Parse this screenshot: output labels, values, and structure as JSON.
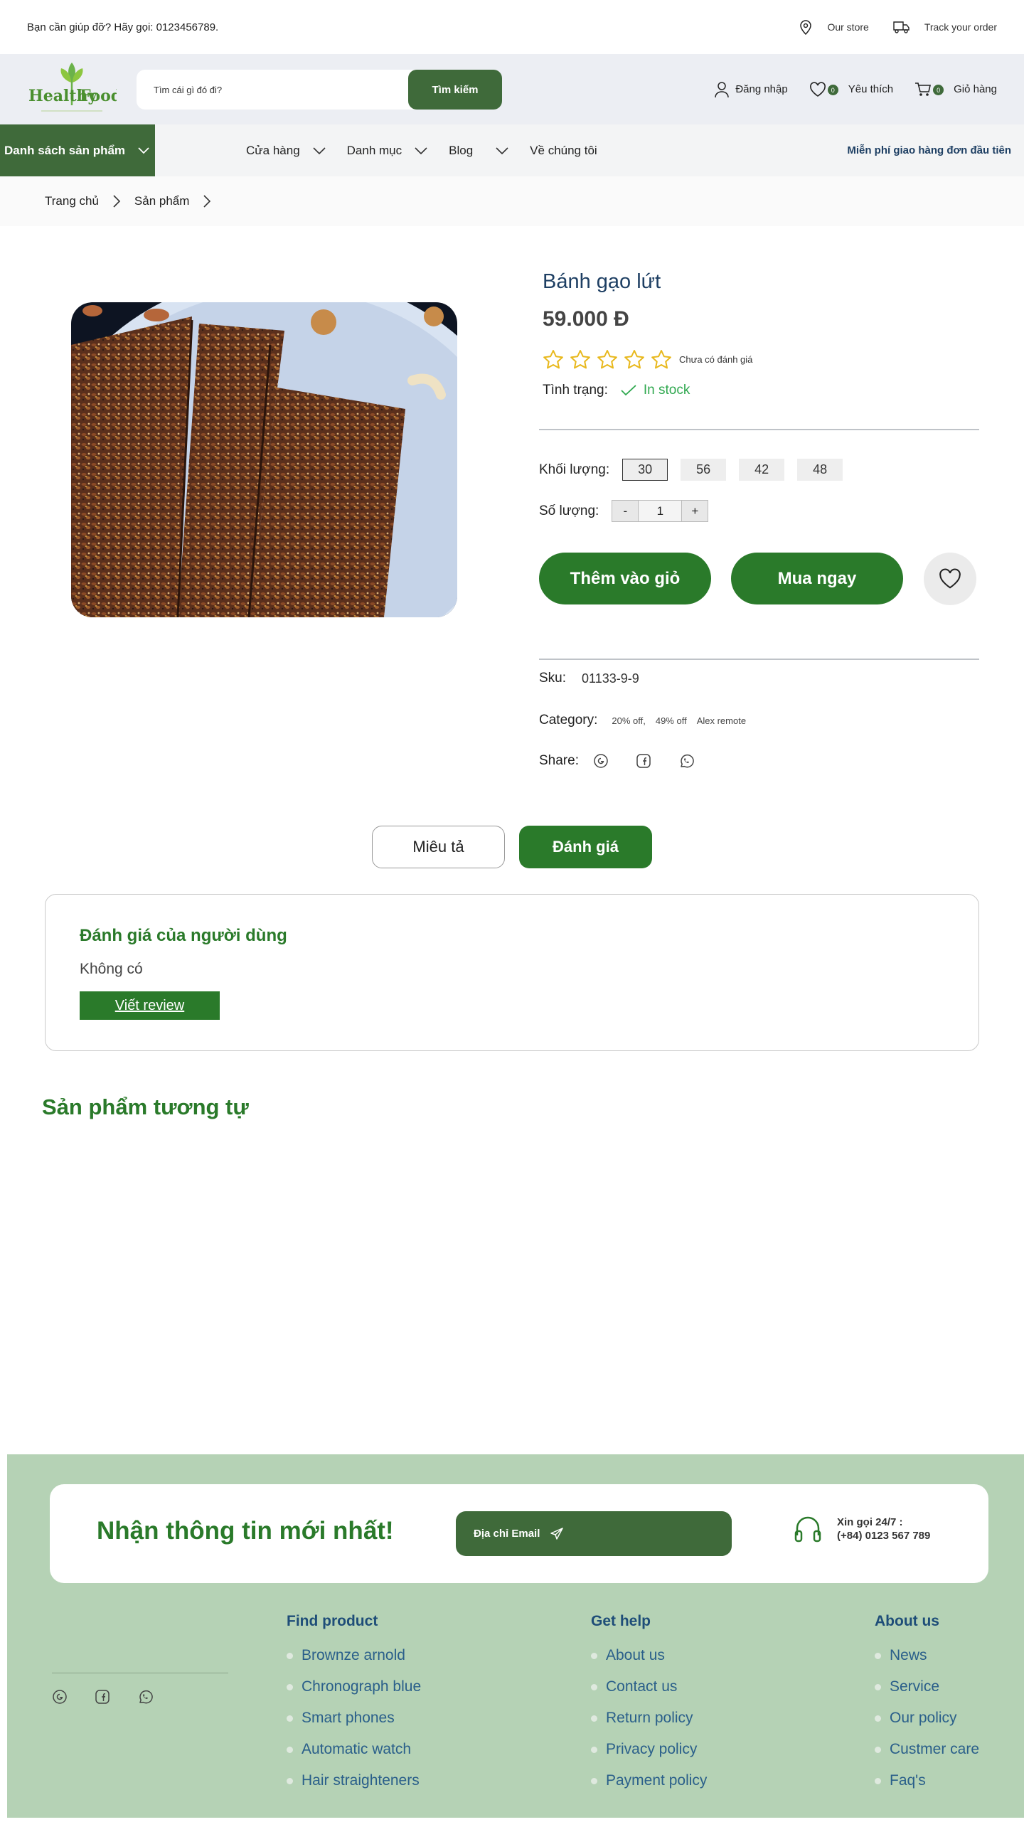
{
  "topbar": {
    "help_text": "Bạn cần giúp đỡ? Hãy gọi: 0123456789.",
    "store_label": "Our store",
    "track_label": "Track your order"
  },
  "header": {
    "logo_text_1": "Healthy",
    "logo_text_2": "Food",
    "search_placeholder": "Tìm cái gì đó đi?",
    "search_button": "Tìm kiếm",
    "login_label": "Đăng nhập",
    "wishlist_count": "0",
    "wishlist_label": "Yêu thích",
    "cart_count": "0",
    "cart_label": "Giỏ hàng"
  },
  "nav": {
    "category_button": "Danh sách sản phẩm",
    "items": [
      {
        "label": "Cửa hàng"
      },
      {
        "label": "Danh mục"
      },
      {
        "label": "Blog"
      },
      {
        "label": "Về chúng tôi"
      }
    ],
    "promo": "Miễn phí giao hàng đơn đầu tiên"
  },
  "breadcrumb": [
    "Trang chủ",
    "Sản phẩm"
  ],
  "product": {
    "title": "Bánh gạo lứt",
    "price": "59.000 Đ",
    "rating_stars": 0,
    "rating_text": "Chưa có đánh giá",
    "status_label": "Tình trạng:",
    "status_value": "In stock",
    "weight_label": "Khối lượng:",
    "weights": [
      "30",
      "56",
      "42",
      "48"
    ],
    "weight_selected": "30",
    "qty_label": "Số lượng:",
    "qty_minus": "-",
    "qty_value": "1",
    "qty_plus": "+",
    "add_to_cart": "Thêm vào giỏ",
    "buy_now": "Mua ngay",
    "sku_label": "Sku:",
    "sku_value": "01133-9-9",
    "category_label": "Category:",
    "categories": [
      "20% off,",
      "49% off",
      "Alex remote"
    ],
    "share_label": "Share:"
  },
  "tabs": {
    "description": "Miêu tả",
    "review": "Đánh giá"
  },
  "reviews": {
    "title": "Đánh giá của người dùng",
    "empty": "Không có",
    "write_button": "Viết review"
  },
  "similar": {
    "title": "Sản phẩm tương tự"
  },
  "footer": {
    "newsletter_title": "Nhận thông tin mới nhất!",
    "email_button": "Địa chỉ Email",
    "phone_line1": "Xin gọi 24/7 :",
    "phone_line2": "(+84) 0123 567 789",
    "columns": [
      {
        "title": "Find product",
        "items": [
          "Brownze arnold",
          "Chronograph blue",
          "Smart phones",
          "Automatic watch",
          "Hair straighteners"
        ]
      },
      {
        "title": "Get help",
        "items": [
          "About us",
          "Contact us",
          "Return policy",
          "Privacy policy",
          "Payment policy"
        ]
      },
      {
        "title": "About us",
        "items": [
          "News",
          "Service",
          "Our policy",
          "Custmer care",
          "Faq's"
        ]
      }
    ]
  },
  "colors": {
    "primary_green": "#2a7a2a",
    "dark_green": "#3f6a3a",
    "title_blue": "#1e3f63",
    "footer_bg": "#b5d2b5",
    "star_yellow": "#e8b81c"
  }
}
